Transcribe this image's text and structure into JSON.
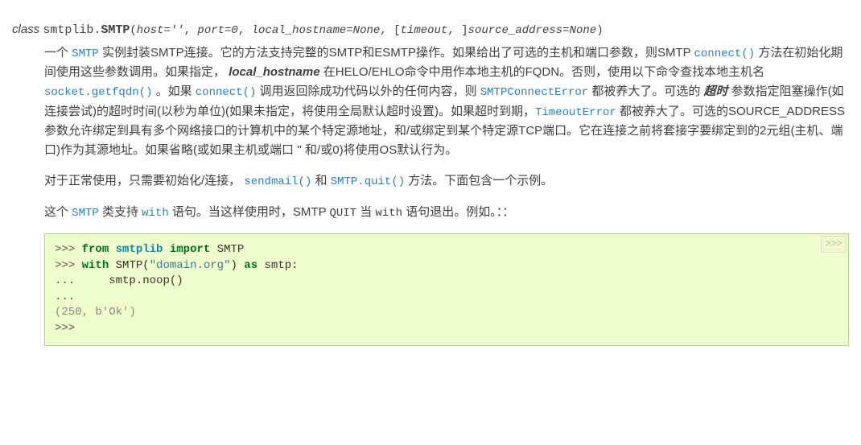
{
  "sig": {
    "kw_class": "class",
    "module": "smtplib.",
    "name": "SMTP",
    "params_html": "host=''",
    "params_text_a": "host=''",
    "params_text_b": "port=0",
    "params_text_c": "local_hostname=None",
    "params_text_d": "timeout",
    "params_text_e": "source_address=None"
  },
  "desc": {
    "p1_a": "一个 ",
    "smtp_link": "SMTP",
    "p1_b": " 实例封装SMTP连接。它的方法支持完整的SMTP和ESMTP操作。如果给出了可选的主机和端口参数，则SMTP ",
    "connect_link": "connect()",
    "p1_c": " 方法在初始化期间使用这些参数调用。如果指定，",
    "local_hostname": "local_hostname",
    "p1_d": " 在HELO/EHLO命令中用作本地主机的FQDN。否则，使用以下命令查找本地主机名 ",
    "getfqdn_link": "socket.getfqdn()",
    "p1_e": " 。如果 ",
    "connect_link2": "connect()",
    "p1_f": " 调用返回除成功代码以外的任何内容，则 ",
    "smtpconnecterror_link": "SMTPConnectError",
    "p1_g": " 都被养大了。可选的 ",
    "timeout_em": "超时",
    "p1_h": " 参数指定阻塞操作(如连接尝试)的超时时间(以秒为单位)(如果未指定，将使用全局默认超时设置)。如果超时到期，",
    "timeouterror_link": "TimeoutError",
    "p1_i": " 都被养大了。可选的SOURCE_ADDRESS参数允许绑定到具有多个网络接口的计算机中的某个特定源地址，和/或绑定到某个特定源TCP端口。它在连接之前将套接字要绑定到的2元组(主机、端口)作为其源地址。如果省略(或如果主机或端口 '' 和/或0)将使用OS默认行为。",
    "p2_a": "对于正常使用，只需要初始化/连接，",
    "sendmail_link": "sendmail()",
    "p2_b": " 和 ",
    "quit_link": "SMTP.quit()",
    "p2_c": " 方法。下面包含一个示例。",
    "p3_a": "这个 ",
    "smtp_link2": "SMTP",
    "p3_b": " 类支持 ",
    "with_link": "with",
    "p3_c": " 语句。当这样使用时，SMTP ",
    "quit_code": "QUIT",
    "p3_d": " 当 ",
    "with_code": "with",
    "p3_e": " 语句退出。例如。：："
  },
  "code": {
    "copybtn": ">>>",
    "l1_prompt": ">>>",
    "l1_from": "from",
    "l1_mod": "smtplib",
    "l1_import": "import",
    "l1_name": "SMTP",
    "l2_prompt": ">>>",
    "l2_with": "with",
    "l2_smtp": "SMTP",
    "l2_open": "(",
    "l2_str": "\"domain.org\"",
    "l2_close": ")",
    "l2_as": "as",
    "l2_var": "smtp",
    "l2_colon": ":",
    "l3_prompt": "...",
    "l3_call": "    smtp.noop()",
    "l4_prompt": "...",
    "l5_out": "(250, b'Ok')",
    "l6_prompt": ">>>"
  }
}
